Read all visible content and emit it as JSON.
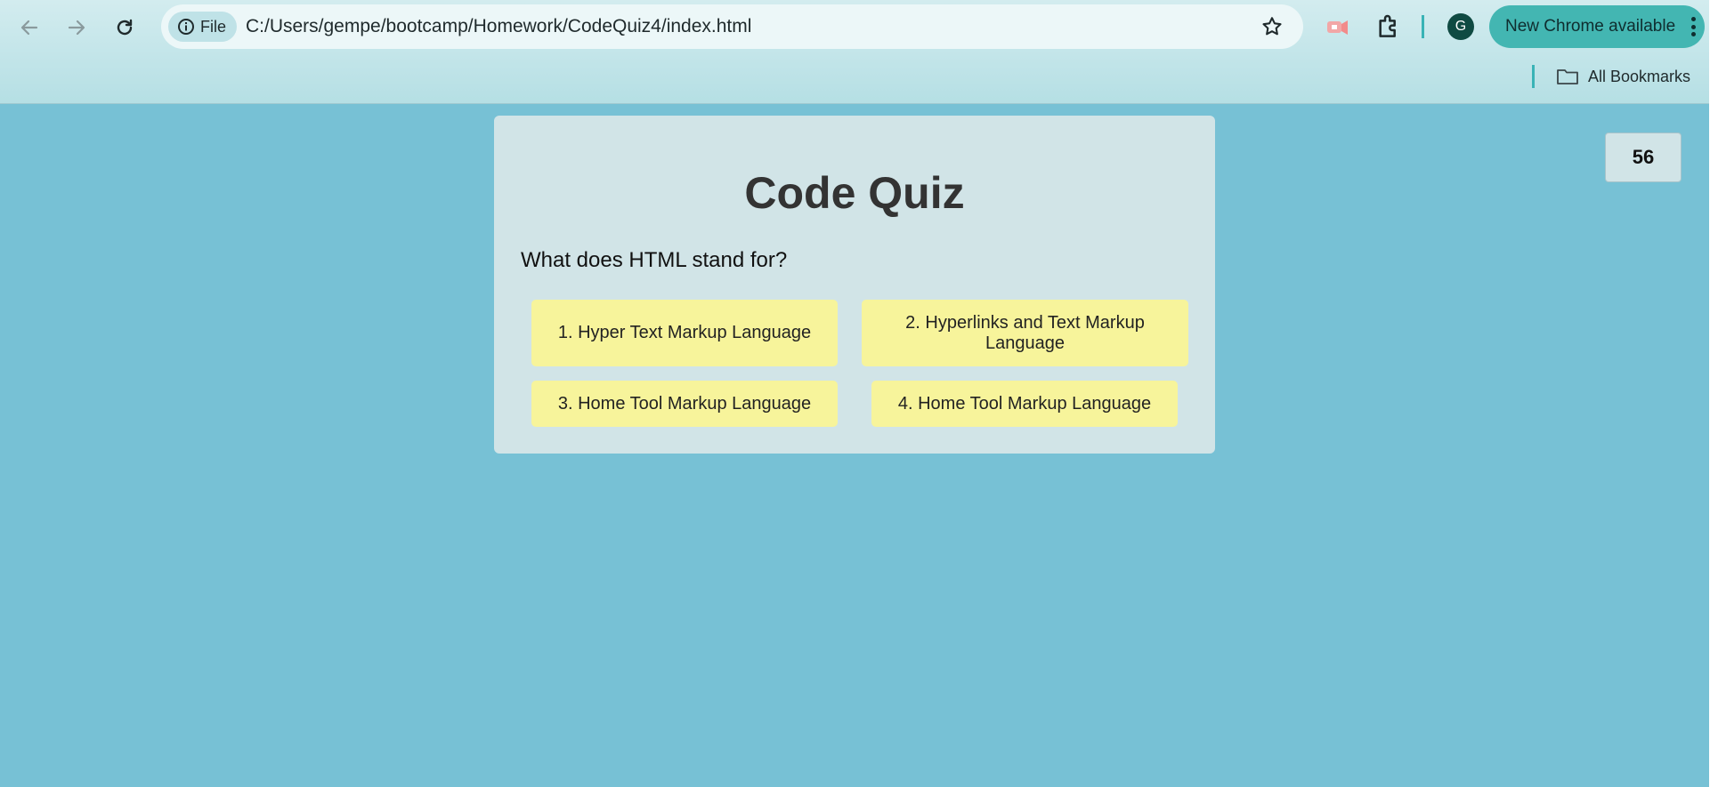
{
  "browser": {
    "site_chip_label": "File",
    "url": "C:/Users/gempe/bootcamp/Homework/CodeQuiz4/index.html",
    "profile_initial": "G",
    "update_button_label": "New Chrome available",
    "bookmarks_label": "All Bookmarks",
    "icons": [
      "back-arrow-icon",
      "forward-arrow-icon",
      "reload-icon",
      "info-icon",
      "star-icon",
      "cast-icon",
      "extensions-icon",
      "more-vert-icon",
      "folder-icon"
    ]
  },
  "quiz": {
    "title": "Code Quiz",
    "question": "What does HTML stand for?",
    "answers": [
      "1. Hyper Text Markup Language",
      "2. Hyperlinks and Text Markup Language",
      "3. Home Tool Markup Language",
      "4. Home Tool Markup Language"
    ],
    "timer": "56"
  },
  "colors": {
    "page_background": "#77c1d5",
    "card_background": "#d1e4e7",
    "answer_background": "#f7f49b",
    "title_text": "#333333",
    "update_button": "#43b6b2"
  }
}
